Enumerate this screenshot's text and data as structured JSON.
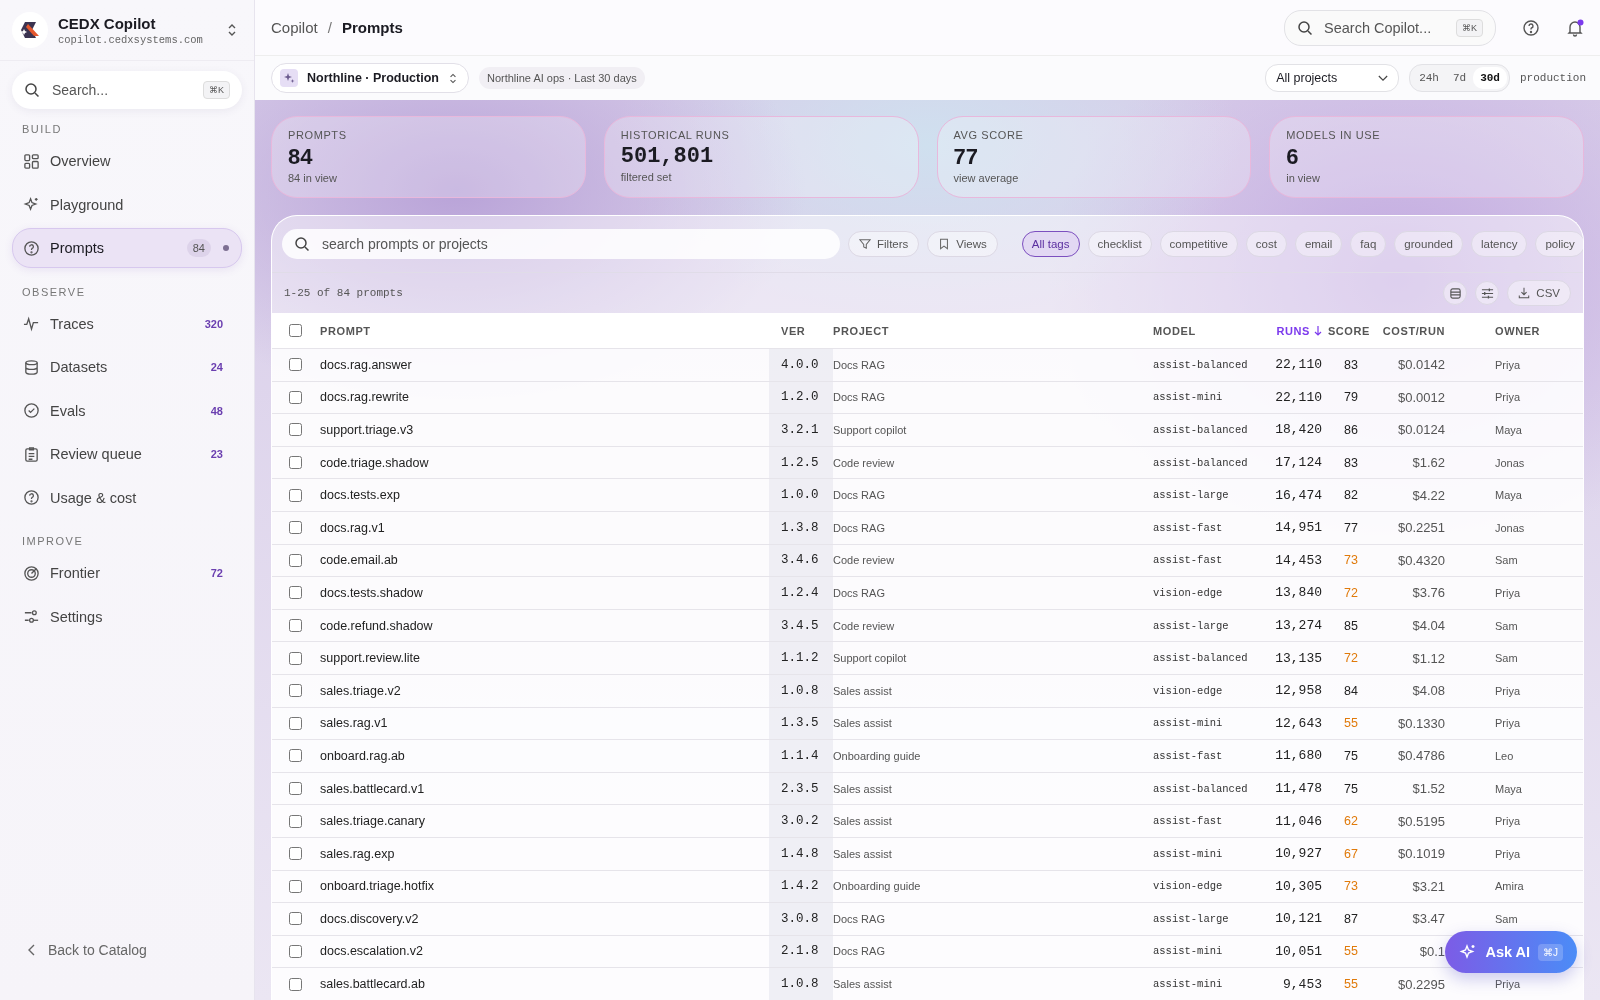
{
  "brand": {
    "name": "CEDX Copilot",
    "domain": "copilot.cedxsystems.com"
  },
  "sidebar": {
    "search": {
      "placeholder": "Search...",
      "shortcut": "⌘K"
    },
    "sections": [
      {
        "title": "BUILD",
        "items": [
          {
            "label": "Overview",
            "selected": false
          },
          {
            "label": "Playground",
            "selected": false
          },
          {
            "label": "Prompts",
            "count": "84",
            "selected": true
          }
        ]
      },
      {
        "title": "OBSERVE",
        "items": [
          {
            "label": "Traces",
            "count": "320",
            "selected": false
          },
          {
            "label": "Datasets",
            "count": "24",
            "selected": false
          },
          {
            "label": "Evals",
            "count": "48",
            "selected": false
          },
          {
            "label": "Review queue",
            "count": "23",
            "selected": false
          },
          {
            "label": "Usage & cost",
            "selected": false
          }
        ]
      },
      {
        "title": "IMPROVE",
        "items": [
          {
            "label": "Frontier",
            "count": "72",
            "selected": false
          },
          {
            "label": "Settings",
            "selected": false
          }
        ]
      }
    ],
    "footer": "Back to Catalog"
  },
  "breadcrumb": [
    "Copilot",
    "Prompts"
  ],
  "breadcrumb_separator": "/",
  "top_search": {
    "placeholder": "Search Copilot...",
    "shortcut": "⌘K"
  },
  "notifications": {
    "unread": true
  },
  "workspace": {
    "name": "Northline · Production",
    "context": "Northline AI ops · Last 30 days"
  },
  "project_select": "All projects",
  "ranges": [
    {
      "label": "24h",
      "selected": false
    },
    {
      "label": "7d",
      "selected": false
    },
    {
      "label": "30d",
      "selected": true
    }
  ],
  "environment": "production",
  "stats": [
    {
      "label": "PROMPTS",
      "value": "84",
      "note": "84 in view"
    },
    {
      "label": "HISTORICAL RUNS",
      "value": "501,801",
      "note": "filtered set"
    },
    {
      "label": "AVG SCORE",
      "value": "77",
      "note": "view average"
    },
    {
      "label": "MODELS IN USE",
      "value": "6",
      "note": "in view"
    }
  ],
  "filter_bar": {
    "placeholder": "search prompts or projects",
    "buttons": [
      "Filters",
      "Views"
    ],
    "tags": [
      {
        "label": "All tags",
        "selected": true
      },
      {
        "label": "checklist",
        "selected": false
      },
      {
        "label": "competitive",
        "selected": false
      },
      {
        "label": "cost",
        "selected": false
      },
      {
        "label": "email",
        "selected": false
      },
      {
        "label": "faq",
        "selected": false
      },
      {
        "label": "grounded",
        "selected": false
      },
      {
        "label": "latency",
        "selected": false
      },
      {
        "label": "policy",
        "selected": false
      }
    ]
  },
  "table": {
    "summary": "1-25 of 84 prompts",
    "export": "CSV",
    "select_all": {
      "checked": false
    },
    "columns": [
      {
        "label": "PROMPT",
        "sorted": false
      },
      {
        "label": "VER",
        "sorted": false
      },
      {
        "label": "PROJECT",
        "sorted": false
      },
      {
        "label": "MODEL",
        "sorted": false
      },
      {
        "label": "RUNS",
        "sorted": true
      },
      {
        "label": "SCORE",
        "sorted": false
      },
      {
        "label": "COST/RUN",
        "sorted": false
      },
      {
        "label": "OWNER",
        "sorted": false
      }
    ],
    "rows": [
      {
        "checked": false,
        "prompt": "docs.rag.answer",
        "ver": "4.0.0",
        "project": "Docs RAG",
        "model": "assist-balanced",
        "runs": "22,110",
        "score": "83",
        "low_score": false,
        "cost": "$0.0142",
        "owner": "Priya"
      },
      {
        "checked": false,
        "prompt": "docs.rag.rewrite",
        "ver": "1.2.0",
        "project": "Docs RAG",
        "model": "assist-mini",
        "runs": "22,110",
        "score": "79",
        "low_score": false,
        "cost": "$0.0012",
        "owner": "Priya"
      },
      {
        "checked": false,
        "prompt": "support.triage.v3",
        "ver": "3.2.1",
        "project": "Support copilot",
        "model": "assist-balanced",
        "runs": "18,420",
        "score": "86",
        "low_score": false,
        "cost": "$0.0124",
        "owner": "Maya"
      },
      {
        "checked": false,
        "prompt": "code.triage.shadow",
        "ver": "1.2.5",
        "project": "Code review",
        "model": "assist-balanced",
        "runs": "17,124",
        "score": "83",
        "low_score": false,
        "cost": "$1.62",
        "owner": "Jonas"
      },
      {
        "checked": false,
        "prompt": "docs.tests.exp",
        "ver": "1.0.0",
        "project": "Docs RAG",
        "model": "assist-large",
        "runs": "16,474",
        "score": "82",
        "low_score": false,
        "cost": "$4.22",
        "owner": "Maya"
      },
      {
        "checked": false,
        "prompt": "docs.rag.v1",
        "ver": "1.3.8",
        "project": "Docs RAG",
        "model": "assist-fast",
        "runs": "14,951",
        "score": "77",
        "low_score": false,
        "cost": "$0.2251",
        "owner": "Jonas"
      },
      {
        "checked": false,
        "prompt": "code.email.ab",
        "ver": "3.4.6",
        "project": "Code review",
        "model": "assist-fast",
        "runs": "14,453",
        "score": "73",
        "low_score": true,
        "cost": "$0.4320",
        "owner": "Sam"
      },
      {
        "checked": false,
        "prompt": "docs.tests.shadow",
        "ver": "1.2.4",
        "project": "Docs RAG",
        "model": "vision-edge",
        "runs": "13,840",
        "score": "72",
        "low_score": true,
        "cost": "$3.76",
        "owner": "Priya"
      },
      {
        "checked": false,
        "prompt": "code.refund.shadow",
        "ver": "3.4.5",
        "project": "Code review",
        "model": "assist-large",
        "runs": "13,274",
        "score": "85",
        "low_score": false,
        "cost": "$4.04",
        "owner": "Sam"
      },
      {
        "checked": false,
        "prompt": "support.review.lite",
        "ver": "1.1.2",
        "project": "Support copilot",
        "model": "assist-balanced",
        "runs": "13,135",
        "score": "72",
        "low_score": true,
        "cost": "$1.12",
        "owner": "Sam"
      },
      {
        "checked": false,
        "prompt": "sales.triage.v2",
        "ver": "1.0.8",
        "project": "Sales assist",
        "model": "vision-edge",
        "runs": "12,958",
        "score": "84",
        "low_score": false,
        "cost": "$4.08",
        "owner": "Priya"
      },
      {
        "checked": false,
        "prompt": "sales.rag.v1",
        "ver": "1.3.5",
        "project": "Sales assist",
        "model": "assist-mini",
        "runs": "12,643",
        "score": "55",
        "low_score": true,
        "cost": "$0.1330",
        "owner": "Priya"
      },
      {
        "checked": false,
        "prompt": "onboard.rag.ab",
        "ver": "1.1.4",
        "project": "Onboarding guide",
        "model": "assist-fast",
        "runs": "11,680",
        "score": "75",
        "low_score": false,
        "cost": "$0.4786",
        "owner": "Leo"
      },
      {
        "checked": false,
        "prompt": "sales.battlecard.v1",
        "ver": "2.3.5",
        "project": "Sales assist",
        "model": "assist-balanced",
        "runs": "11,478",
        "score": "75",
        "low_score": false,
        "cost": "$1.52",
        "owner": "Maya"
      },
      {
        "checked": false,
        "prompt": "sales.triage.canary",
        "ver": "3.0.2",
        "project": "Sales assist",
        "model": "assist-fast",
        "runs": "11,046",
        "score": "62",
        "low_score": true,
        "cost": "$0.5195",
        "owner": "Priya"
      },
      {
        "checked": false,
        "prompt": "sales.rag.exp",
        "ver": "1.4.8",
        "project": "Sales assist",
        "model": "assist-mini",
        "runs": "10,927",
        "score": "67",
        "low_score": true,
        "cost": "$0.1019",
        "owner": "Priya"
      },
      {
        "checked": false,
        "prompt": "onboard.triage.hotfix",
        "ver": "1.4.2",
        "project": "Onboarding guide",
        "model": "vision-edge",
        "runs": "10,305",
        "score": "73",
        "low_score": true,
        "cost": "$3.21",
        "owner": "Amira"
      },
      {
        "checked": false,
        "prompt": "docs.discovery.v2",
        "ver": "3.0.8",
        "project": "Docs RAG",
        "model": "assist-large",
        "runs": "10,121",
        "score": "87",
        "low_score": false,
        "cost": "$3.47",
        "owner": "Sam"
      },
      {
        "checked": false,
        "prompt": "docs.escalation.v2",
        "ver": "2.1.8",
        "project": "Docs RAG",
        "model": "assist-mini",
        "runs": "10,051",
        "score": "55",
        "low_score": true,
        "cost": "$0.1"
      },
      {
        "checked": false,
        "prompt": "sales.battlecard.ab",
        "ver": "1.0.8",
        "project": "Sales assist",
        "model": "assist-mini",
        "runs": "9,453",
        "score": "55",
        "low_score": true,
        "cost": "$0.2295",
        "owner": "Priya"
      }
    ]
  },
  "ask_ai": {
    "label": "Ask AI",
    "shortcut": "⌘J"
  }
}
